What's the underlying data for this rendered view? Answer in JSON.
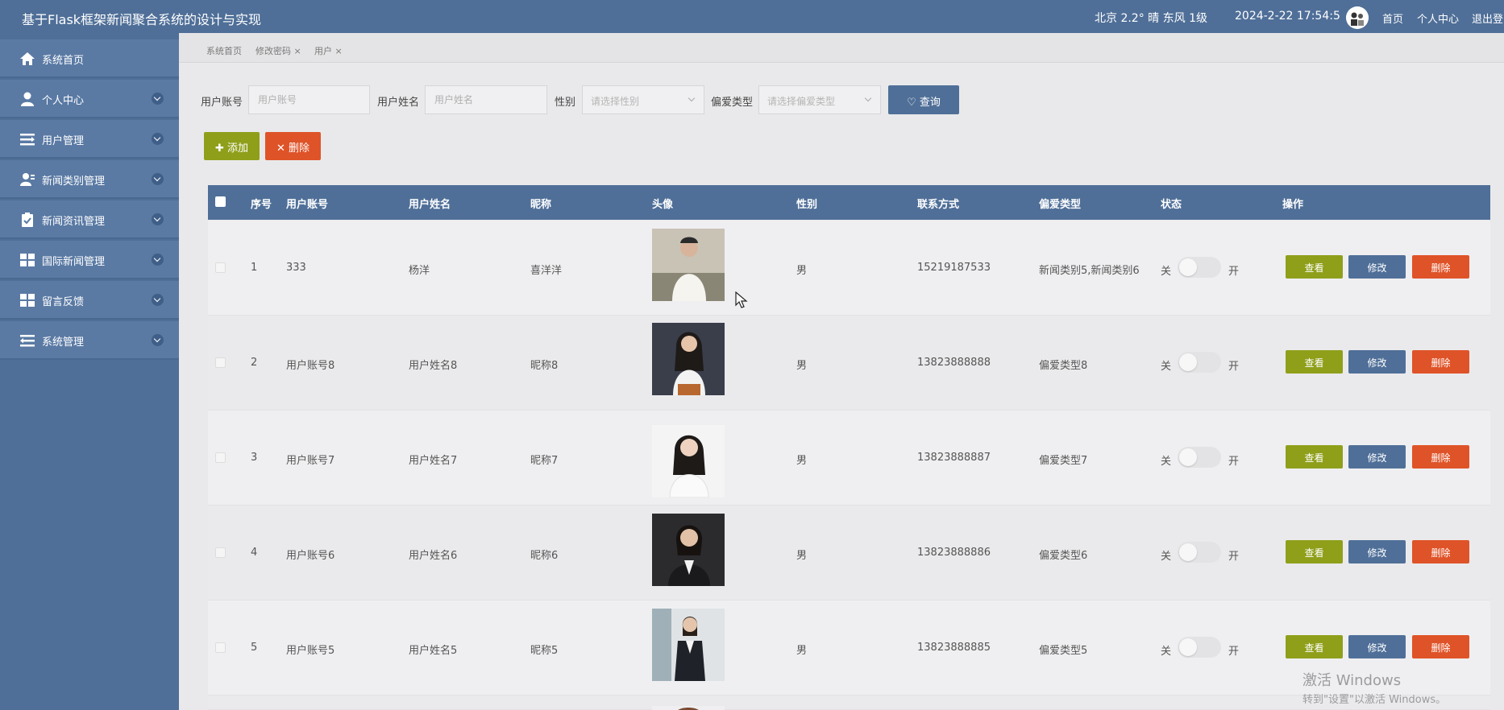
{
  "header": {
    "title": "基于Flask框架新闻聚合系统的设计与实现",
    "weather": "北京  2.2°  晴  东风  1级",
    "datetime": "2024-2-22 17:54:5",
    "nav_home": "首页",
    "nav_profile": "个人中心",
    "nav_logout": "退出登"
  },
  "sidebar": {
    "items": [
      {
        "label": "系统首页",
        "icon": "home-icon"
      },
      {
        "label": "个人中心",
        "icon": "user-icon"
      },
      {
        "label": "用户管理",
        "icon": "list-icon"
      },
      {
        "label": "新闻类别管理",
        "icon": "user-group-icon"
      },
      {
        "label": "新闻资讯管理",
        "icon": "clipboard-icon"
      },
      {
        "label": "国际新闻管理",
        "icon": "grid-icon"
      },
      {
        "label": "留言反馈",
        "icon": "grid-icon"
      },
      {
        "label": "系统管理",
        "icon": "list-icon"
      }
    ]
  },
  "tabs": [
    "系统首页",
    "修改密码 ×",
    "用户 ×"
  ],
  "search": {
    "account_label": "用户账号",
    "account_placeholder": "用户账号",
    "name_label": "用户姓名",
    "name_placeholder": "用户姓名",
    "gender_label": "性别",
    "gender_placeholder": "请选择性别",
    "pref_label": "偏爱类型",
    "pref_placeholder": "请选择偏爱类型",
    "query_label": "♡ 查询"
  },
  "actions": {
    "add_label": "✚ 添加",
    "delete_label": "✕ 删除"
  },
  "table": {
    "columns": [
      "序号",
      "用户账号",
      "用户姓名",
      "昵称",
      "头像",
      "性别",
      "联系方式",
      "偏爱类型",
      "状态",
      "操作"
    ],
    "toggle_off": "关",
    "toggle_on": "开",
    "view_label": "查看",
    "edit_label": "修改",
    "delete_label": "删除",
    "rows": [
      {
        "index": "1",
        "account": "333",
        "name": "杨洋",
        "nickname": "喜洋洋",
        "gender": "男",
        "phone": "15219187533",
        "pref": "新闻类别5,新闻类别6"
      },
      {
        "index": "2",
        "account": "用户账号8",
        "name": "用户姓名8",
        "nickname": "昵称8",
        "gender": "男",
        "phone": "13823888888",
        "pref": "偏爱类型8"
      },
      {
        "index": "3",
        "account": "用户账号7",
        "name": "用户姓名7",
        "nickname": "昵称7",
        "gender": "男",
        "phone": "13823888887",
        "pref": "偏爱类型7"
      },
      {
        "index": "4",
        "account": "用户账号6",
        "name": "用户姓名6",
        "nickname": "昵称6",
        "gender": "男",
        "phone": "13823888886",
        "pref": "偏爱类型6"
      },
      {
        "index": "5",
        "account": "用户账号5",
        "name": "用户姓名5",
        "nickname": "昵称5",
        "gender": "男",
        "phone": "13823888885",
        "pref": "偏爱类型5"
      }
    ]
  },
  "watermark": {
    "line1": "激活 Windows",
    "line2": "转到\"设置\"以激活 Windows。"
  },
  "colors": {
    "primary": "#4f6f98",
    "view": "#8f9f1a",
    "danger": "#df5328"
  }
}
